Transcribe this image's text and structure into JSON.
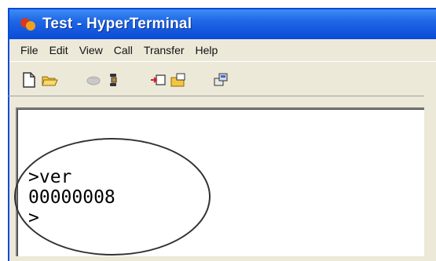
{
  "window": {
    "title": "Test - HyperTerminal"
  },
  "menu": [
    "File",
    "Edit",
    "View",
    "Call",
    "Transfer",
    "Help"
  ],
  "toolbar": {
    "icons": [
      "new-icon",
      "open-icon",
      "disconnect-icon",
      "dial-icon",
      "send-icon",
      "receive-icon",
      "properties-icon"
    ]
  },
  "terminal": {
    "lines": [
      ">ver",
      "00000008",
      ">"
    ]
  },
  "colors": {
    "titlebar": "#0a4bd6",
    "chrome": "#ece9d8",
    "terminal_bg": "#ffffff"
  }
}
